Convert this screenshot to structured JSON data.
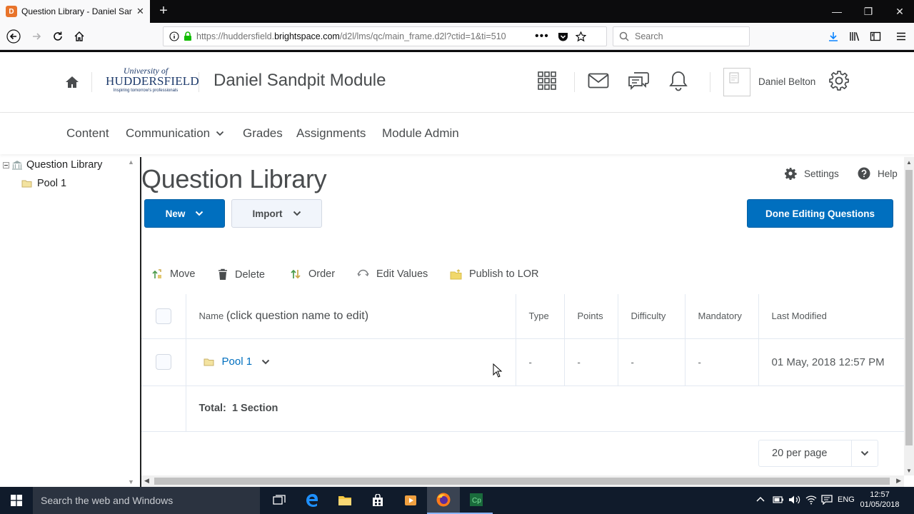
{
  "browser": {
    "tab_title": "Question Library - Daniel Sandpit",
    "tab_favicon": "D",
    "url_prefix": "https://huddersfield.",
    "url_domain": "brightspace.com",
    "url_rest": "/d2l/lms/qc/main_frame.d2l?ctid=1&ti=510",
    "search_placeholder": "Search"
  },
  "header": {
    "logo_line1": "University of",
    "logo_line2": "HUDDERSFIELD",
    "logo_line3": "Inspiring tomorrow's professionals",
    "course_title": "Daniel Sandpit Module",
    "user_name": "Daniel Belton"
  },
  "navbar": {
    "items": [
      "Content",
      "Communication",
      "Grades",
      "Assignments",
      "Module Admin"
    ]
  },
  "tree": {
    "root": "Question Library",
    "child": "Pool 1"
  },
  "page": {
    "title": "Question Library",
    "settings_label": "Settings",
    "help_label": "Help",
    "new_label": "New",
    "import_label": "Import",
    "done_label": "Done Editing Questions",
    "actions": [
      "Move",
      "Delete",
      "Order",
      "Edit Values",
      "Publish to LOR"
    ]
  },
  "table": {
    "name_header_small": "Name",
    "name_header_large": "(click question name to edit)",
    "headers": [
      "Type",
      "Points",
      "Difficulty",
      "Mandatory",
      "Last Modified"
    ],
    "row": {
      "name": "Pool 1",
      "type": "-",
      "points": "-",
      "difficulty": "-",
      "mandatory": "-",
      "last_modified": "01 May, 2018 12:57 PM"
    },
    "total_label": "Total:",
    "total_value": "1 Section"
  },
  "pager": {
    "label": "20 per page"
  },
  "taskbar": {
    "search_placeholder": "Search the web and Windows",
    "lang": "ENG",
    "time": "12:57",
    "date": "01/05/2018"
  },
  "colors": {
    "primary_button": "#006fbf",
    "link": "#006fbf",
    "taskbar": "#101b2b"
  }
}
